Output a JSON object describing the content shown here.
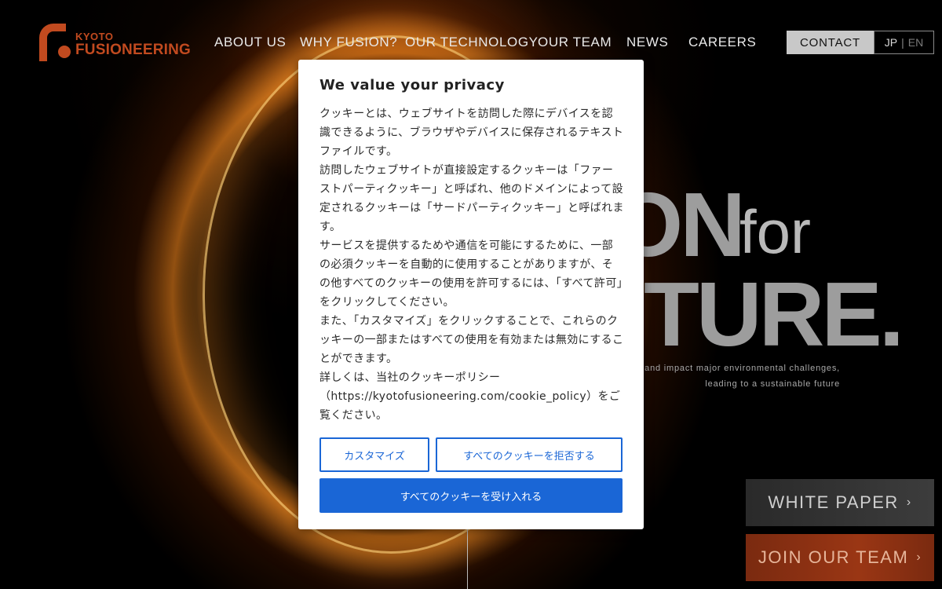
{
  "brand": {
    "small": "KYOTO",
    "big": "FUSIONEERING",
    "color": "#c14a1f"
  },
  "nav": {
    "items": [
      {
        "label": "ABOUT US"
      },
      {
        "label": "WHY FUSION?"
      },
      {
        "label": "OUR TECHNOLOGY"
      },
      {
        "label": "OUR TEAM"
      },
      {
        "label": "NEWS"
      },
      {
        "label": "CAREERS"
      }
    ],
    "contact": "CONTACT",
    "lang_jp": "JP",
    "lang_sep": "|",
    "lang_en": "EN"
  },
  "hero": {
    "word1": "ON",
    "for": "for",
    "word2": "TURE.",
    "sub1": "ry and impact major environmental challenges,",
    "sub2": "leading to a sustainable future"
  },
  "banners": {
    "white_paper": "WHITE PAPER",
    "join_team": "JOIN OUR TEAM",
    "chevron": "›"
  },
  "cookie": {
    "title": "We value your privacy",
    "paragraphs": [
      "クッキーとは、ウェブサイトを訪問した際にデバイスを認識できるように、ブラウザやデバイスに保存されるテキストファイルです。",
      "訪問したウェブサイトが直接設定するクッキーは「ファーストパーティクッキー」と呼ばれ、他のドメインによって設定されるクッキーは「サードパーティクッキー」と呼ばれます。",
      "サービスを提供するためや通信を可能にするために、一部の必須クッキーを自動的に使用することがありますが、その他すべてのクッキーの使用を許可するには、「すべて許可」をクリックしてください。",
      "また、「カスタマイズ」をクリックすることで、これらのクッキーの一部またはすべての使用を有効または無効にすることができます。",
      "詳しくは、当社のクッキーポリシー（https://kyotofusioneering.com/cookie_policy）をご覧ください。"
    ],
    "customize": "カスタマイズ",
    "reject": "すべてのクッキーを拒否する",
    "accept": "すべてのクッキーを受け入れる",
    "accent": "#1a66d6"
  }
}
